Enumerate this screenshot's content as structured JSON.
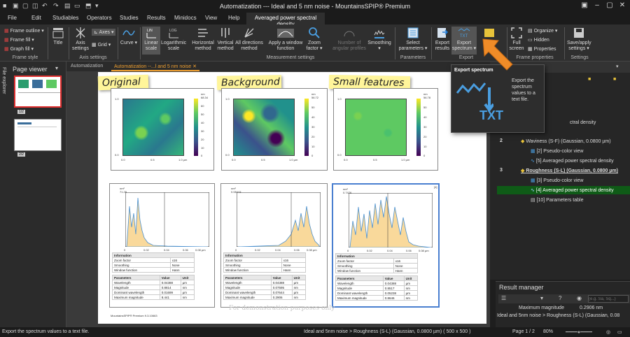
{
  "app": {
    "title": "Automatization --- Ideal and 5 nm noise - MountainsSPIP® Premium"
  },
  "menu": {
    "tabs": [
      "File",
      "Edit",
      "Studiables",
      "Operators",
      "Studies",
      "Results",
      "Minidocs",
      "View",
      "Help"
    ],
    "active_tab": "Averaged power spectral density"
  },
  "ribbon": {
    "frame_outline": "Frame outline",
    "frame_fill": "Frame fill",
    "graph_fill": "Graph fill",
    "frame_style": "Frame style",
    "title": "Title",
    "axis_settings": "Axis settings",
    "axes": "Axes",
    "grid": "Grid",
    "axis_group": "Axis settings",
    "curve": "Curve",
    "linear_scale": "Linear scale",
    "log_scale": "Logarithmic scale",
    "horizontal_method": "Horizontal method",
    "vertical_method": "Vertical method",
    "all_directions_method": "All directions method",
    "apply_window": "Apply a window function",
    "zoom_factor": "Zoom factor",
    "angular_profiles": "Number of angular profiles",
    "smoothing": "Smoothing",
    "measurement_group": "Measurement settings",
    "select_parameters": "Select parameters",
    "parameters_group": "Parameters",
    "export_results": "Export results",
    "export_spectrum": "Export spectrum",
    "export_group": "Export",
    "full_screen": "Full screen",
    "organize": "Organize",
    "hidden": "Hidden",
    "properties": "Properties",
    "frame_properties_group": "Frame properties",
    "save_apply": "Save/apply settings",
    "settings_group": "Settings"
  },
  "left": {
    "file_explorer": "File explorer",
    "page_viewer": "Page viewer",
    "thumb1": "1/2",
    "thumb2": "2/2"
  },
  "doc_tabs": [
    "Automatization",
    "Automatization --...l and 5 nm noise"
  ],
  "document": {
    "labels": [
      "Original",
      "Background",
      "Small features"
    ],
    "colorbars": [
      {
        "unit": "nm",
        "max": "68.34",
        "ticks": [
          "60",
          "50",
          "40",
          "30",
          "20",
          "10",
          "0"
        ]
      },
      {
        "unit": "nm",
        "max": "56.72",
        "ticks": [
          "50",
          "40",
          "30",
          "20",
          "10",
          "0"
        ]
      },
      {
        "unit": "nm",
        "max": "56.78",
        "ticks": [
          "50",
          "40",
          "30",
          "20",
          "10",
          "0"
        ]
      }
    ],
    "map_axis": {
      "x_ticks": [
        "0.0",
        "0.5",
        "1.0 µm"
      ],
      "y_ticks": [
        "1.0",
        "0.8",
        "0.6",
        "0.4",
        "0.2",
        "0.0"
      ]
    },
    "spectra": [
      {
        "unit": "nm²",
        "max": "71.25",
        "x_ticks": [
          "0",
          "0.02",
          "0.04",
          "0.06",
          "0.08 µm"
        ]
      },
      {
        "unit": "nm²",
        "max": "0.08443",
        "x_ticks": [
          "0",
          "0.02",
          "0.04",
          "0.06",
          "0.08 µm"
        ]
      },
      {
        "unit": "nm²",
        "max": "0.7476",
        "x_ticks": [
          "0",
          "0.02",
          "0.04",
          "0.06",
          "0.08 µm"
        ]
      }
    ],
    "table_headers": {
      "information": "Information",
      "parameters": "Parameters",
      "value": "Value",
      "unit": "Unit"
    },
    "info_rows": [
      [
        "Zoom factor",
        "x16"
      ],
      [
        "Smoothing",
        "None"
      ],
      [
        "Window function",
        "Hann"
      ]
    ],
    "param_tables": [
      [
        [
          "Wavelength",
          "0.04388",
          "µm"
        ],
        [
          "Magnitude",
          "0.8814",
          "nm"
        ],
        [
          "Dominant wavelength",
          "0.01699",
          "µm"
        ],
        [
          "Maximum magnitude",
          "8.441",
          "nm"
        ]
      ],
      [
        [
          "Wavelength",
          "0.04388",
          "µm"
        ],
        [
          "Magnitude",
          "0.07595",
          "nm"
        ],
        [
          "Dominant wavelength",
          "0.07644",
          "µm"
        ],
        [
          "Maximum magnitude",
          "0.2906",
          "nm"
        ]
      ],
      [
        [
          "Wavelength",
          "0.04388",
          "µm"
        ],
        [
          "Magnitude",
          "0.8517",
          "nm"
        ],
        [
          "Dominant wavelength",
          "0.05238",
          "µm"
        ],
        [
          "Maximum magnitude",
          "0.8646",
          "nm"
        ]
      ]
    ],
    "frame_badge": "[4]",
    "watermark": "For demonstration purposes only",
    "footer": "MountainsSPIP® Premium 9.3.10663"
  },
  "tooltip": {
    "title": "Export spectrum",
    "text": "Export the spectrum values to a text file.",
    "badge": "TXT"
  },
  "tree": {
    "partial": "ctral density",
    "n2": "2",
    "waviness": "Waviness (S-F) (Gaussian, 0.0800 µm)",
    "w_pseudo": "[2] Pseudo-color view",
    "w_apsd": "[5] Averaged power spectral density",
    "n3": "3",
    "roughness": "Roughness (S-L) (Gaussian, 0.0800 µm)",
    "r_pseudo": "[3] Pseudo-color view",
    "r_apsd": "[4] Averaged power spectral density",
    "r_params": "[10] Parameters table"
  },
  "result_manager": {
    "title": "Result manager",
    "search_placeholder": "(e.g. Sa, Sq...)",
    "row1_label": "Maximum magnitude",
    "row1_value": "0.2906 nm",
    "row2": "Ideal and 5nm noise > Roughness (S-L) (Gaussian, 0.08"
  },
  "status": {
    "left": "Export the spectrum values to a text file.",
    "middle": "Ideal and 5nm noise > Roughness (S-L) (Gaussian, 0.0800 µm) ( 500 x 500 )",
    "page": "Page 1 / 2",
    "zoom": "80%"
  },
  "colors": {
    "accent": "#f08c28",
    "highlight_row": "#0f5b17",
    "sticky": "#fff59a"
  }
}
